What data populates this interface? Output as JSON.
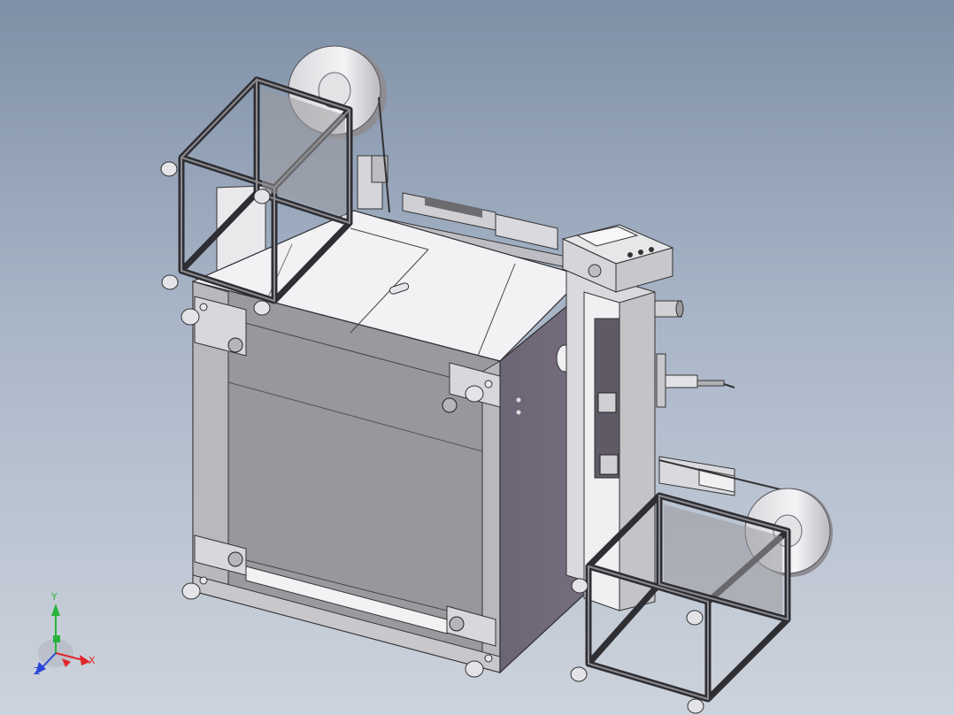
{
  "colors": {
    "bg_top": "#7f90a6",
    "bg_bottom": "#cdd3dc",
    "body_front": "#9b999d",
    "body_side": "#6f6878",
    "top_surface": "#f2f2f4",
    "frame_dark": "#2e2e33",
    "axis_x": "#e0262a",
    "axis_y": "#27b33c",
    "axis_z": "#2a45d8"
  },
  "icons": {
    "triad": "orientation-triad-icon"
  },
  "triad": {
    "x_label": "X",
    "y_label": "Y",
    "z_label": "Z"
  }
}
